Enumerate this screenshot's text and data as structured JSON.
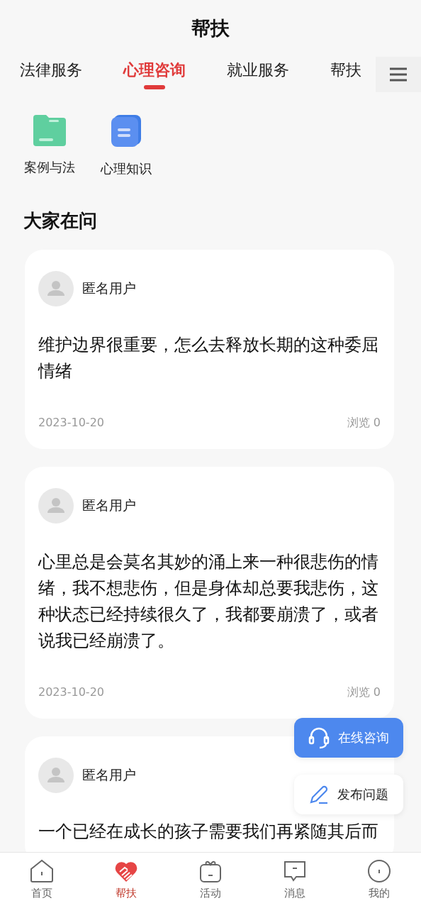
{
  "header": {
    "title": "帮扶"
  },
  "tabs": [
    {
      "label": "法律服务",
      "selected": false
    },
    {
      "label": "心理咨询",
      "selected": true
    },
    {
      "label": "就业服务",
      "selected": false
    },
    {
      "label": "帮扶",
      "selected": false
    }
  ],
  "shortcuts": [
    {
      "kind": "folder",
      "label": "案例与法"
    },
    {
      "kind": "document",
      "label": "心理知识"
    }
  ],
  "section": {
    "title": "大家在问"
  },
  "questions": [
    {
      "user": "匿名用户",
      "text": "维护边界很重要，怎么去释放长期的这种委屈情绪",
      "date": "2023-10-20",
      "views": "浏览 0"
    },
    {
      "user": "匿名用户",
      "text": "心里总是会莫名其妙的涌上来一种很悲伤的情绪，我不想悲伤，但是身体却总要我悲伤，这种状态已经持续很久了，我都要崩溃了，或者说我已经崩溃了。",
      "date": "2023-10-20",
      "views": "浏览 0"
    },
    {
      "user": "匿名用户",
      "text": "一个已经在成长的孩子需要我们再紧随其后而"
    }
  ],
  "floating_buttons": [
    {
      "kind": "consult",
      "label": "在线咨询"
    },
    {
      "kind": "post",
      "label": "发布问题"
    }
  ],
  "bottom_nav": [
    {
      "kind": "home",
      "label": "首页",
      "selected": false
    },
    {
      "kind": "help",
      "label": "帮扶",
      "selected": true
    },
    {
      "kind": "activity",
      "label": "活动",
      "selected": false
    },
    {
      "kind": "message",
      "label": "消息",
      "selected": false
    },
    {
      "kind": "profile",
      "label": "我的",
      "selected": false
    }
  ]
}
